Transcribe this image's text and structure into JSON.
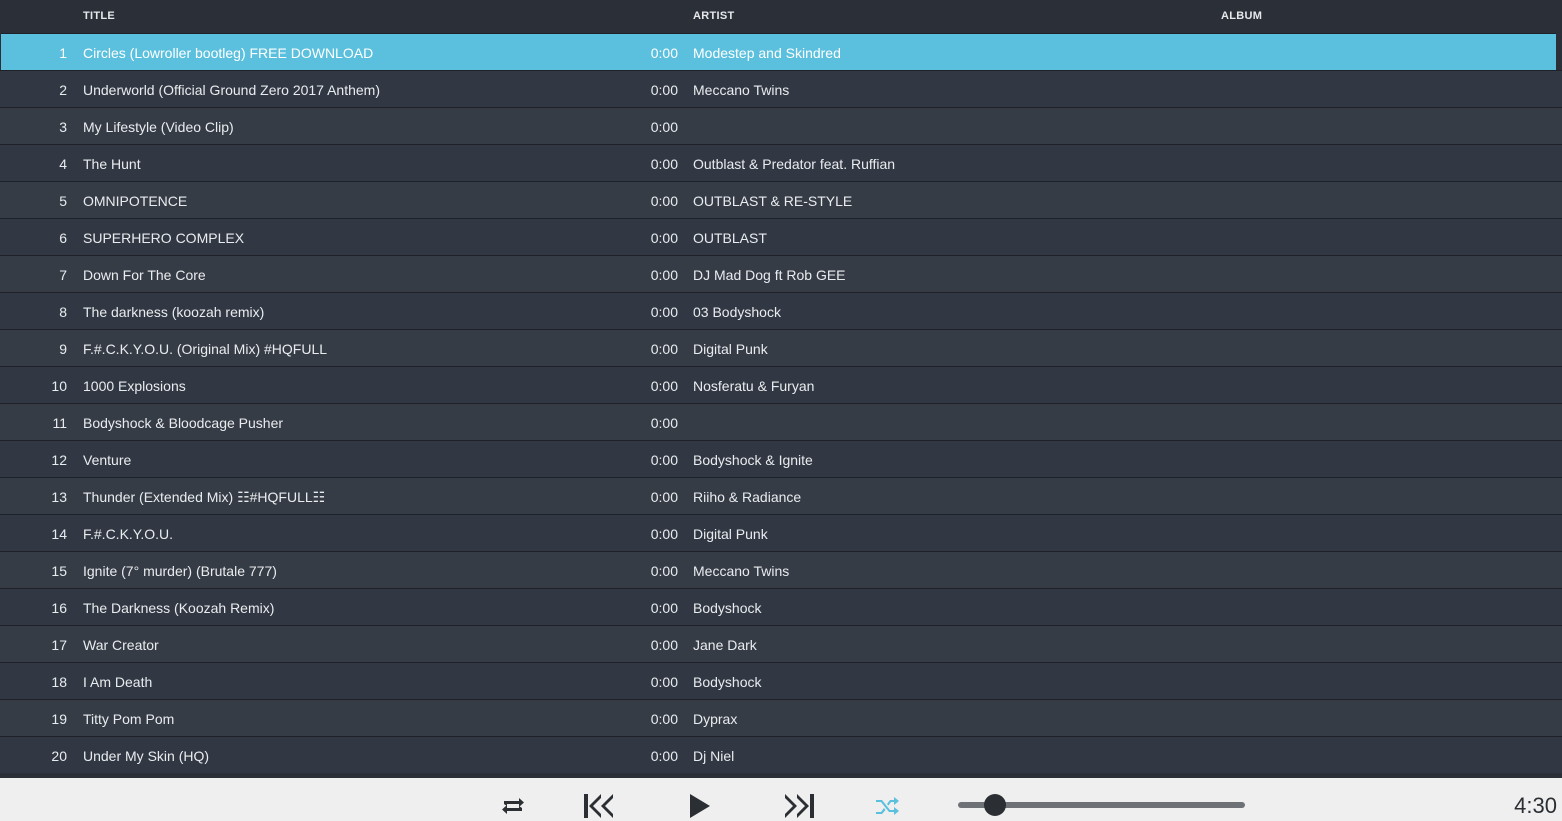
{
  "columns": {
    "title": "TITLE",
    "artist": "ARTIST",
    "album": "ALBUM"
  },
  "tracks": [
    {
      "num": "1",
      "title": "Circles (Lowroller bootleg) FREE DOWNLOAD",
      "duration": "0:00",
      "artist": "Modestep and Skindred",
      "selected": true
    },
    {
      "num": "2",
      "title": "Underworld (Official Ground Zero 2017 Anthem)",
      "duration": "0:00",
      "artist": "Meccano Twins"
    },
    {
      "num": "3",
      "title": "My Lifestyle (Video Clip)",
      "duration": "0:00",
      "artist": ""
    },
    {
      "num": "4",
      "title": "The Hunt",
      "duration": "0:00",
      "artist": "Outblast & Predator feat. Ruffian"
    },
    {
      "num": "5",
      "title": "OMNIPOTENCE",
      "duration": "0:00",
      "artist": "OUTBLAST & RE-STYLE"
    },
    {
      "num": "6",
      "title": "SUPERHERO COMPLEX",
      "duration": "0:00",
      "artist": "OUTBLAST"
    },
    {
      "num": "7",
      "title": "Down For The Core",
      "duration": "0:00",
      "artist": "DJ Mad Dog ft Rob GEE"
    },
    {
      "num": "8",
      "title": "The darkness (koozah remix)",
      "duration": "0:00",
      "artist": "03 Bodyshock"
    },
    {
      "num": "9",
      "title": "F.#.C.K.Y.O.U. (Original Mix) #HQFULL",
      "duration": "0:00",
      "artist": "Digital Punk"
    },
    {
      "num": "10",
      "title": "1000 Explosions",
      "duration": "0:00",
      "artist": "Nosferatu & Furyan"
    },
    {
      "num": "11",
      "title": "Bodyshock & Bloodcage Pusher",
      "duration": "0:00",
      "artist": ""
    },
    {
      "num": "12",
      "title": "Venture",
      "duration": "0:00",
      "artist": "Bodyshock & Ignite"
    },
    {
      "num": "13",
      "title": "Thunder (Extended Mix) ☷#HQFULL☷",
      "duration": "0:00",
      "artist": "Riiho & Radiance"
    },
    {
      "num": "14",
      "title": "F.#.C.K.Y.O.U.",
      "duration": "0:00",
      "artist": "Digital Punk"
    },
    {
      "num": "15",
      "title": "Ignite (7° murder) (Brutale 777)",
      "duration": "0:00",
      "artist": "Meccano Twins"
    },
    {
      "num": "16",
      "title": "The Darkness (Koozah Remix)",
      "duration": "0:00",
      "artist": "Bodyshock"
    },
    {
      "num": "17",
      "title": "War Creator",
      "duration": "0:00",
      "artist": "Jane Dark"
    },
    {
      "num": "18",
      "title": "I Am Death",
      "duration": "0:00",
      "artist": "Bodyshock"
    },
    {
      "num": "19",
      "title": "Titty Pom Pom",
      "duration": "0:00",
      "artist": "Dyprax"
    },
    {
      "num": "20",
      "title": "Under My Skin (HQ)",
      "duration": "0:00",
      "artist": "Dj Niel"
    }
  ],
  "player": {
    "controls": [
      {
        "icon": "repeat-icon",
        "active": false
      },
      {
        "icon": "skip-previous-icon",
        "active": false
      },
      {
        "icon": "play-icon",
        "active": false
      },
      {
        "icon": "skip-next-icon",
        "active": false
      },
      {
        "icon": "shuffle-icon",
        "active": true
      }
    ],
    "progress_fraction": 0.13,
    "time": "4:30"
  },
  "colors": {
    "selected_row": "#5bc0de",
    "background": "#2b3038",
    "player_bar": "#efefef",
    "active_icon": "#5bc0de",
    "icon": "#2b2f33"
  }
}
